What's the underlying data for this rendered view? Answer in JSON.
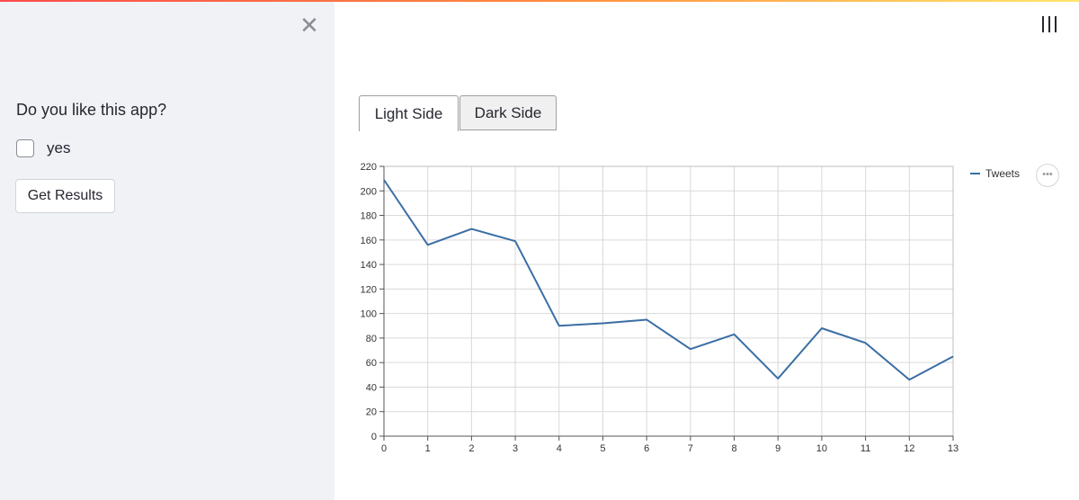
{
  "sidebar": {
    "close_label": "✕",
    "question": "Do you like this app?",
    "checkbox_label": "yes",
    "checkbox_checked": false,
    "button_label": "Get Results"
  },
  "tabs": [
    {
      "label": "Light Side",
      "active": true
    },
    {
      "label": "Dark Side",
      "active": false
    }
  ],
  "chart_menu_label": "•••",
  "colors": {
    "line": "#3a6ea5",
    "sidebar_bg": "#f0f2f6",
    "grid": "#d9d9d9"
  },
  "chart_data": {
    "type": "line",
    "x": [
      0,
      1,
      2,
      3,
      4,
      5,
      6,
      7,
      8,
      9,
      10,
      11,
      12,
      13
    ],
    "series": [
      {
        "name": "Tweets",
        "values": [
          209,
          156,
          169,
          159,
          90,
          92,
          95,
          71,
          83,
          47,
          88,
          76,
          46,
          65
        ]
      }
    ],
    "xlim": [
      0,
      13
    ],
    "ylim": [
      0,
      220
    ],
    "yticks": [
      0,
      20,
      40,
      60,
      80,
      100,
      120,
      140,
      160,
      180,
      200,
      220
    ],
    "xticks": [
      0,
      1,
      2,
      3,
      4,
      5,
      6,
      7,
      8,
      9,
      10,
      11,
      12,
      13
    ],
    "grid": true,
    "legend_position": "top-right"
  }
}
